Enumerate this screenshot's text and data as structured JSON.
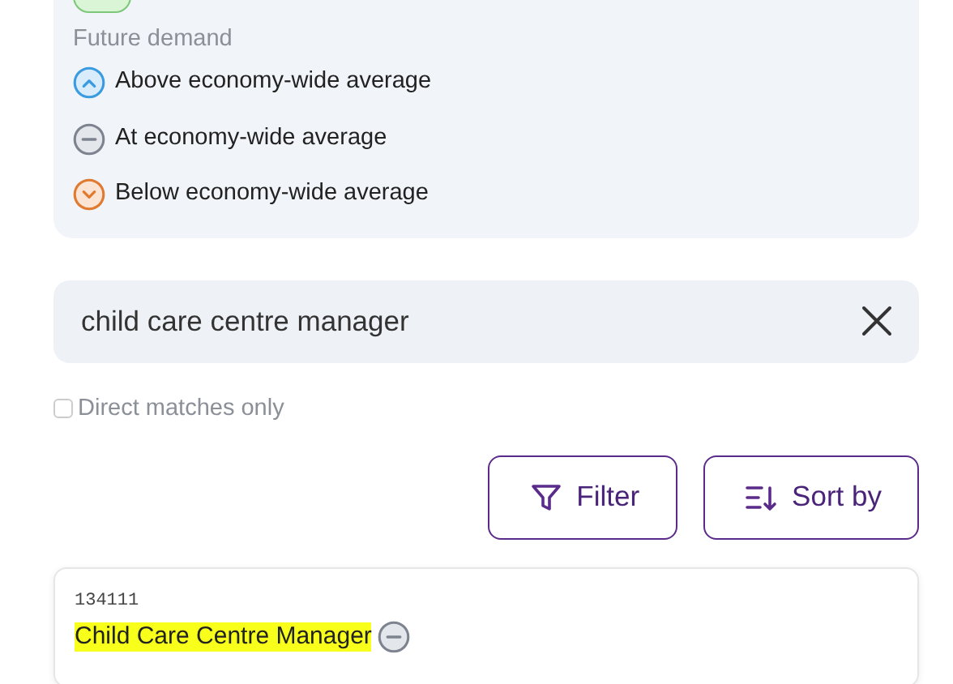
{
  "legend": {
    "shortage_items": [
      {
        "color": "#d9f5d6"
      }
    ],
    "future_demand_title": "Future demand",
    "future_demand": [
      {
        "kind": "above",
        "label": "Above economy-wide average"
      },
      {
        "kind": "at",
        "label": "At economy-wide average"
      },
      {
        "kind": "below",
        "label": "Below economy-wide average"
      }
    ]
  },
  "search": {
    "value": "child care centre manager"
  },
  "direct_matches": {
    "label": "Direct matches only",
    "checked": false
  },
  "buttons": [
    {
      "kind": "filter",
      "label": "Filter"
    },
    {
      "kind": "sort",
      "label": "Sort by"
    }
  ],
  "results": [
    {
      "code": "134111",
      "title": "Child Care Centre Manager",
      "kind": "at",
      "highlighted": true
    }
  ]
}
